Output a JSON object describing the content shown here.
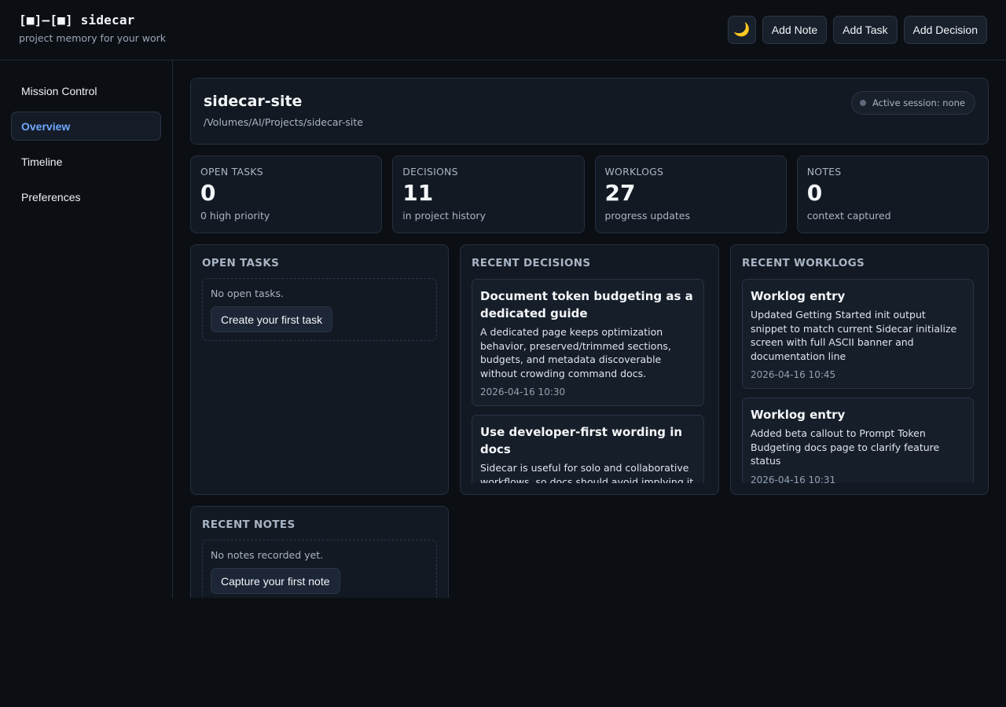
{
  "header": {
    "logo": "[■]—[■] sidecar",
    "tagline": "project memory for your work",
    "theme_toggle_icon": "🌙",
    "buttons": [
      "Add Note",
      "Add Task",
      "Add Decision"
    ]
  },
  "sidebar": {
    "items": [
      {
        "label": "Mission Control",
        "active": false
      },
      {
        "label": "Overview",
        "active": true
      },
      {
        "label": "Timeline",
        "active": false
      },
      {
        "label": "Preferences",
        "active": false
      }
    ]
  },
  "project": {
    "name": "sidecar-site",
    "path": "/Volumes/AI/Projects/sidecar-site",
    "session": "Active session: none"
  },
  "stats": [
    {
      "label": "Open tasks",
      "value": "0",
      "sub": "0 high priority"
    },
    {
      "label": "Decisions",
      "value": "11",
      "sub": "in project history"
    },
    {
      "label": "Worklogs",
      "value": "27",
      "sub": "progress updates"
    },
    {
      "label": "Notes",
      "value": "0",
      "sub": "context captured"
    }
  ],
  "open_tasks": {
    "title": "Open Tasks",
    "empty_text": "No open tasks.",
    "button": "Create your first task"
  },
  "recent_decisions": {
    "title": "Recent Decisions",
    "items": [
      {
        "title": "Document token budgeting as a dedicated guide",
        "body": "A dedicated page keeps optimization behavior, preserved/trimmed sections, budgets, and metadata discoverable without crowding command docs.",
        "time": "2026-04-16 10:30"
      },
      {
        "title": "Use developer-first wording in docs",
        "body": "Sidecar is useful for solo and collaborative workflows, so docs should avoid implying it is",
        "time": ""
      }
    ]
  },
  "recent_worklogs": {
    "title": "Recent Worklogs",
    "items": [
      {
        "title": "Worklog entry",
        "body": "Updated Getting Started init output snippet to match current Sidecar initialize screen with full ASCII banner and documentation line",
        "time": "2026-04-16 10:45"
      },
      {
        "title": "Worklog entry",
        "body": "Added beta callout to Prompt Token Budgeting docs page to clarify feature status",
        "time": "2026-04-16 10:31"
      }
    ]
  },
  "recent_notes": {
    "title": "Recent Notes",
    "empty_text": "No notes recorded yet.",
    "button": "Capture your first note"
  }
}
